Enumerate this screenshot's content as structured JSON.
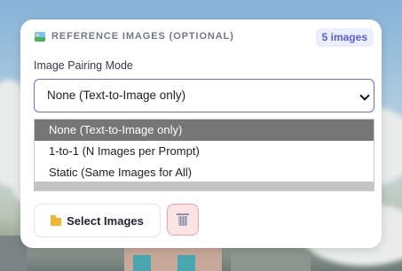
{
  "section": {
    "title": "REFERENCE IMAGES (OPTIONAL)",
    "count_badge": "5 images",
    "icon": "picture-icon"
  },
  "pairing": {
    "label": "Image Pairing Mode",
    "selected": "None (Text-to-Image only)",
    "options": [
      "None (Text-to-Image only)",
      "1-to-1 (N Images per Prompt)",
      "Static (Same Images for All)"
    ]
  },
  "actions": {
    "select_label": "Select Images",
    "select_icon": "folder-icon",
    "clear_icon": "trash-icon"
  },
  "colors": {
    "accent": "#6b6fe0",
    "badge_text": "#5b5fd8",
    "danger_bg": "#fde4e4"
  }
}
